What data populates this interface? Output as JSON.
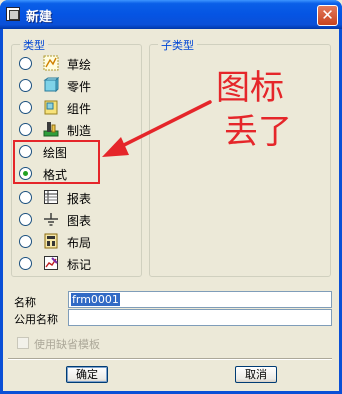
{
  "window": {
    "title": "新建",
    "close_glyph": "✕"
  },
  "type_group": {
    "legend": "类型",
    "items": [
      {
        "label": "草绘",
        "icon": "sketch-icon",
        "checked": false
      },
      {
        "label": "零件",
        "icon": "part-icon",
        "checked": false
      },
      {
        "label": "组件",
        "icon": "assembly-icon",
        "checked": false
      },
      {
        "label": "制造",
        "icon": "manufacturing-icon",
        "checked": false
      },
      {
        "label": "绘图",
        "icon": "",
        "checked": false
      },
      {
        "label": "格式",
        "icon": "",
        "checked": true
      },
      {
        "label": "报表",
        "icon": "report-icon",
        "checked": false
      },
      {
        "label": "图表",
        "icon": "diagram-icon",
        "checked": false
      },
      {
        "label": "布局",
        "icon": "layout-icon",
        "checked": false
      },
      {
        "label": "标记",
        "icon": "markup-icon",
        "checked": false
      }
    ]
  },
  "subtype_group": {
    "legend": "子类型"
  },
  "annotation": {
    "line1": "图标",
    "line2": "丢了",
    "color": "#E5262A"
  },
  "fields": {
    "name_label": "名称",
    "name_value": "frm0001",
    "common_name_label": "公用名称",
    "common_name_value": ""
  },
  "use_default_template": {
    "label": "使用缺省模板",
    "checked": false,
    "enabled": false
  },
  "buttons": {
    "ok": "确定",
    "cancel": "取消"
  }
}
